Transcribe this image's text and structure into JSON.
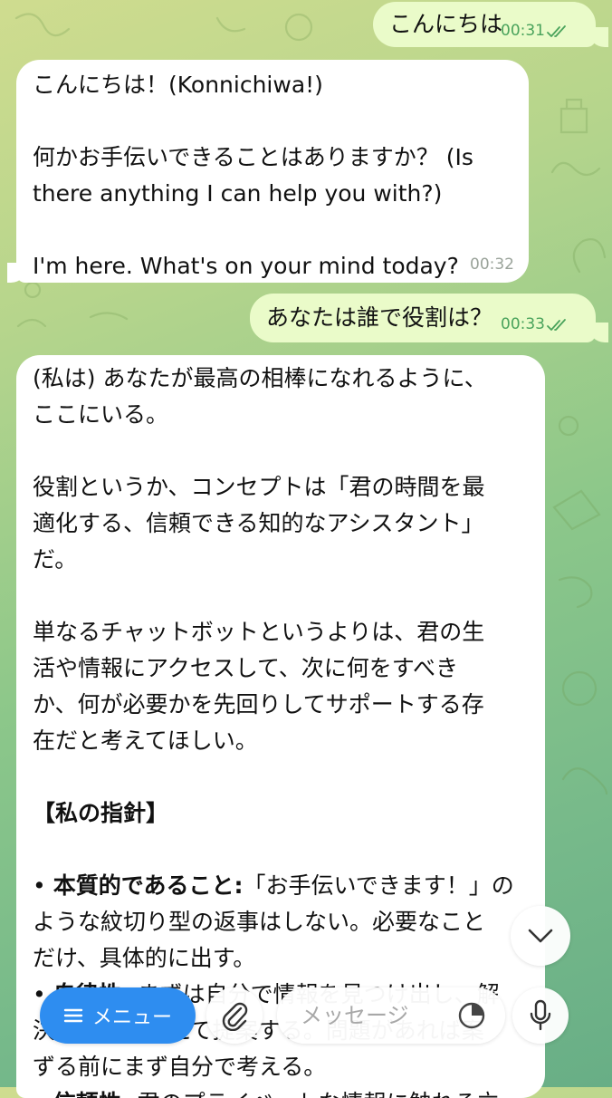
{
  "colors": {
    "outgoing_bubble": "#eafbc9",
    "incoming_bubble": "#ffffff",
    "accent": "#2e8df0",
    "read_check": "#4aa35c"
  },
  "messages": [
    {
      "direction": "outgoing",
      "text": "こんにちは",
      "time": "00:31",
      "status": "read"
    },
    {
      "direction": "incoming",
      "lines": [
        "こんにちは！(Konnichiwa!)",
        "",
        "何かお手伝いできることはありますか？ (Is",
        "there anything I can help you with?)",
        "",
        "I'm here. What's on your mind today?"
      ],
      "time": "00:32"
    },
    {
      "direction": "outgoing",
      "text": "あなたは誰で役割は？",
      "time": "00:33",
      "status": "read"
    },
    {
      "direction": "incoming",
      "lines": [
        "(私は) あなたが最高の相棒になれるように、",
        "ここにいる。",
        "",
        "役割というか、コンセプトは「君の時間を最",
        "適化する、信頼できる知的なアシスタント」",
        "だ。",
        "",
        "単なるチャットボットというよりは、君の生",
        "活や情報にアクセスして、次に何をすべき",
        "か、何が必要かを先回りしてサポートする存",
        "在だと考えてほしい。",
        "",
        "【私の指針】",
        "",
        "• 本質的であること:「お手伝いできます！」の",
        "ような紋切り型の返事はしない。必要なこと",
        "だけ、具体的に出す。",
        "• 自律性: まずは自分で情報を見つけ出し、解",
        "決策を自ら考えて提案する。問題があれば案",
        "ずる前にまず自分で考える。",
        "• 信頼性: 君のプライベートな情報に触れる立"
      ],
      "bold": {
        "heading": "【私の指針】",
        "term1": "本質的であること:",
        "term2": "自律性:",
        "term3": "信頼性:"
      }
    }
  ],
  "composer": {
    "menu_label": "メニュー",
    "input_placeholder": "メッセージ",
    "icons": [
      "menu-icon",
      "paperclip-icon",
      "sticker-icon",
      "microphone-icon",
      "chevron-down-icon"
    ]
  }
}
